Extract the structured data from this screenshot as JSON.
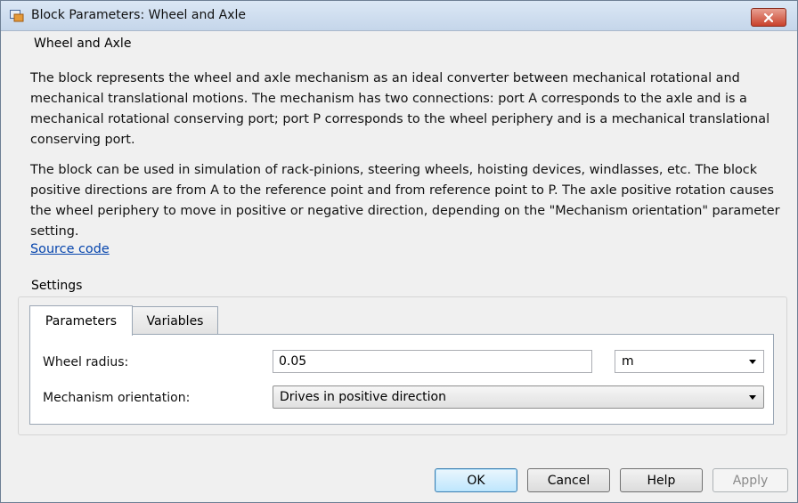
{
  "window": {
    "title": "Block Parameters: Wheel and Axle",
    "icon": "simulink-block-icon"
  },
  "description": {
    "group_label": "Wheel and Axle",
    "paragraph1": "The block represents the wheel and axle mechanism as an ideal converter between mechanical rotational and mechanical translational motions. The mechanism has two connections: port A corresponds to the axle and is a mechanical rotational conserving port; port P corresponds to the wheel periphery and is a mechanical translational conserving port.",
    "paragraph2": "The block can be used in simulation of rack-pinions, steering wheels, hoisting devices, windlasses, etc. The block positive directions are from A to the reference point and from reference point to P. The axle positive rotation causes the wheel periphery to move in positive or negative direction, depending on the \"Mechanism orientation\" parameter setting.",
    "source_link": "Source code"
  },
  "settings": {
    "group_label": "Settings",
    "tabs": [
      {
        "label": "Parameters",
        "active": true
      },
      {
        "label": "Variables",
        "active": false
      }
    ],
    "wheel_radius": {
      "label": "Wheel radius:",
      "value": "0.05",
      "unit": "m"
    },
    "mechanism_orientation": {
      "label": "Mechanism orientation:",
      "value": "Drives in positive direction"
    }
  },
  "buttons": {
    "ok": "OK",
    "cancel": "Cancel",
    "help": "Help",
    "apply": "Apply"
  },
  "colors": {
    "link": "#0645ad",
    "close_button": "#c9412b"
  }
}
